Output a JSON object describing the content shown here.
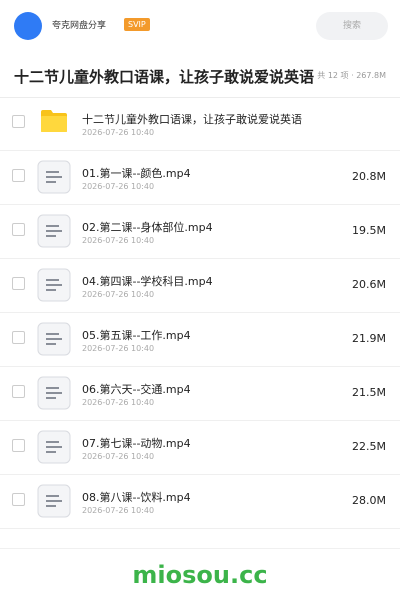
{
  "header": {
    "app_name": "夸克网盘分享",
    "badge": "SVIP",
    "search_placeholder": "搜索",
    "avatar_color": "#2f7bf5",
    "badge_color": "#f39a2b"
  },
  "folder": {
    "title": "十二节儿童外教口语课，让孩子敢说爱说英语",
    "meta": "共 12 项 · 267.8M"
  },
  "files": [
    {
      "type": "folder",
      "name": "十二节儿童外教口语课，让孩子敢说爱说英语",
      "date": "2026-07-26 10:40",
      "size": ""
    },
    {
      "type": "video",
      "name": "01.第一课--颜色.mp4",
      "date": "2026-07-26 10:40",
      "size": "20.8M"
    },
    {
      "type": "video",
      "name": "02.第二课--身体部位.mp4",
      "date": "2026-07-26 10:40",
      "size": "19.5M"
    },
    {
      "type": "video",
      "name": "04.第四课--学校科目.mp4",
      "date": "2026-07-26 10:40",
      "size": "20.6M"
    },
    {
      "type": "video",
      "name": "05.第五课--工作.mp4",
      "date": "2026-07-26 10:40",
      "size": "21.9M"
    },
    {
      "type": "video",
      "name": "06.第六天--交通.mp4",
      "date": "2026-07-26 10:40",
      "size": "21.5M"
    },
    {
      "type": "video",
      "name": "07.第七课--动物.mp4",
      "date": "2026-07-26 10:40",
      "size": "22.5M"
    },
    {
      "type": "video",
      "name": "08.第八课--饮料.mp4",
      "date": "2026-07-26 10:40",
      "size": "28.0M"
    }
  ],
  "watermark": "miosou.cc",
  "colors": {
    "folder_icon": "#f8c31a",
    "watermark": "#3cb44a"
  }
}
